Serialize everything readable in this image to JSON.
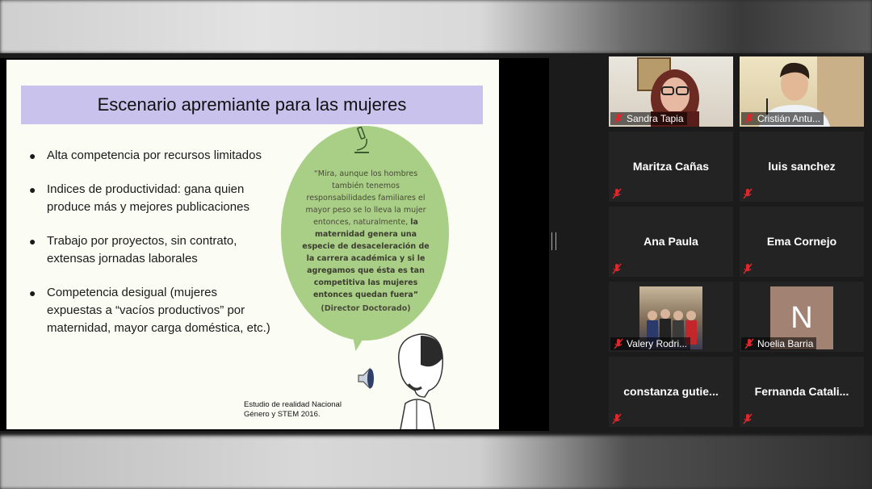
{
  "slide": {
    "title": "Escenario apremiante para las mujeres",
    "bullets": [
      "Alta competencia por recursos limitados",
      "Indices de productividad: gana quien produce más y mejores publicaciones",
      "Trabajo por proyectos, sin contrato, extensas jornadas laborales",
      "Competencia desigual (mujeres expuestas a “vacíos productivos” por maternidad, mayor carga doméstica, etc.)"
    ],
    "quote_normal": "“Mira, aunque los hombres también tenemos responsabilidades familiares el mayor peso se lo lleva la mujer entonces, naturalmente, ",
    "quote_bold": "la maternidad genera una especie de desaceleración de la carrera académica y si le agregamos que ésta es tan competitiva las mujeres entonces quedan fuera”",
    "quote_source": "(Director Doctorado)",
    "study_line1": "Estudio de realidad Nacional",
    "study_line2": "Género y STEM 2016."
  },
  "participants": [
    {
      "name": "Sandra Tapia",
      "type": "video"
    },
    {
      "name": "Cristián Antu...",
      "type": "video"
    },
    {
      "name": "Maritza Cañas",
      "type": "name"
    },
    {
      "name": "luis sanchez",
      "type": "name"
    },
    {
      "name": "Ana Paula",
      "type": "name"
    },
    {
      "name": "Ema Cornejo",
      "type": "name"
    },
    {
      "name": "Valery Rodri...",
      "type": "photo"
    },
    {
      "name": "Noelia Barria",
      "type": "initial",
      "initial": "N"
    },
    {
      "name": "constanza gutie...",
      "type": "name"
    },
    {
      "name": "Fernanda Catali...",
      "type": "name"
    }
  ],
  "icons": {
    "muted_mic": "mic-muted-icon",
    "microscope": "microscope-icon",
    "speaker": "speaker-icon"
  },
  "colors": {
    "title_bar": "#c9c2ec",
    "bubble": "#a9cf86",
    "muted_red": "#e0262b",
    "tile_bg": "#232323"
  }
}
